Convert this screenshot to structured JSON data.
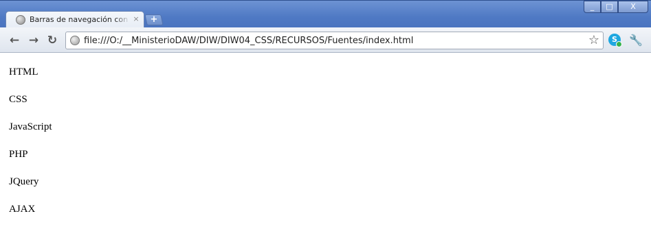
{
  "browser": {
    "tab": {
      "title": "Barras de navegación con li",
      "close_glyph": "×",
      "favicon": "globe-icon"
    },
    "new_tab_glyph": "+",
    "window_controls": {
      "minimize_glyph": "_",
      "maximize_glyph": "□",
      "close_glyph": "X"
    },
    "toolbar": {
      "back_glyph": "←",
      "forward_glyph": "→",
      "reload_glyph": "↻",
      "star_glyph": "☆",
      "wrench_glyph": "🔧",
      "extension_glyph": "S"
    },
    "address_bar": {
      "url": "file:///O:/__MinisterioDAW/DIW/DIW04_CSS/RECURSOS/Fuentes/index.html"
    }
  },
  "page": {
    "items": [
      "HTML",
      "CSS",
      "JavaScript",
      "PHP",
      "JQuery",
      "AJAX"
    ]
  },
  "colors": {
    "titlebar": "#4f79c4",
    "toolbar": "#e6ebf2",
    "page_background": "#ffffff"
  }
}
